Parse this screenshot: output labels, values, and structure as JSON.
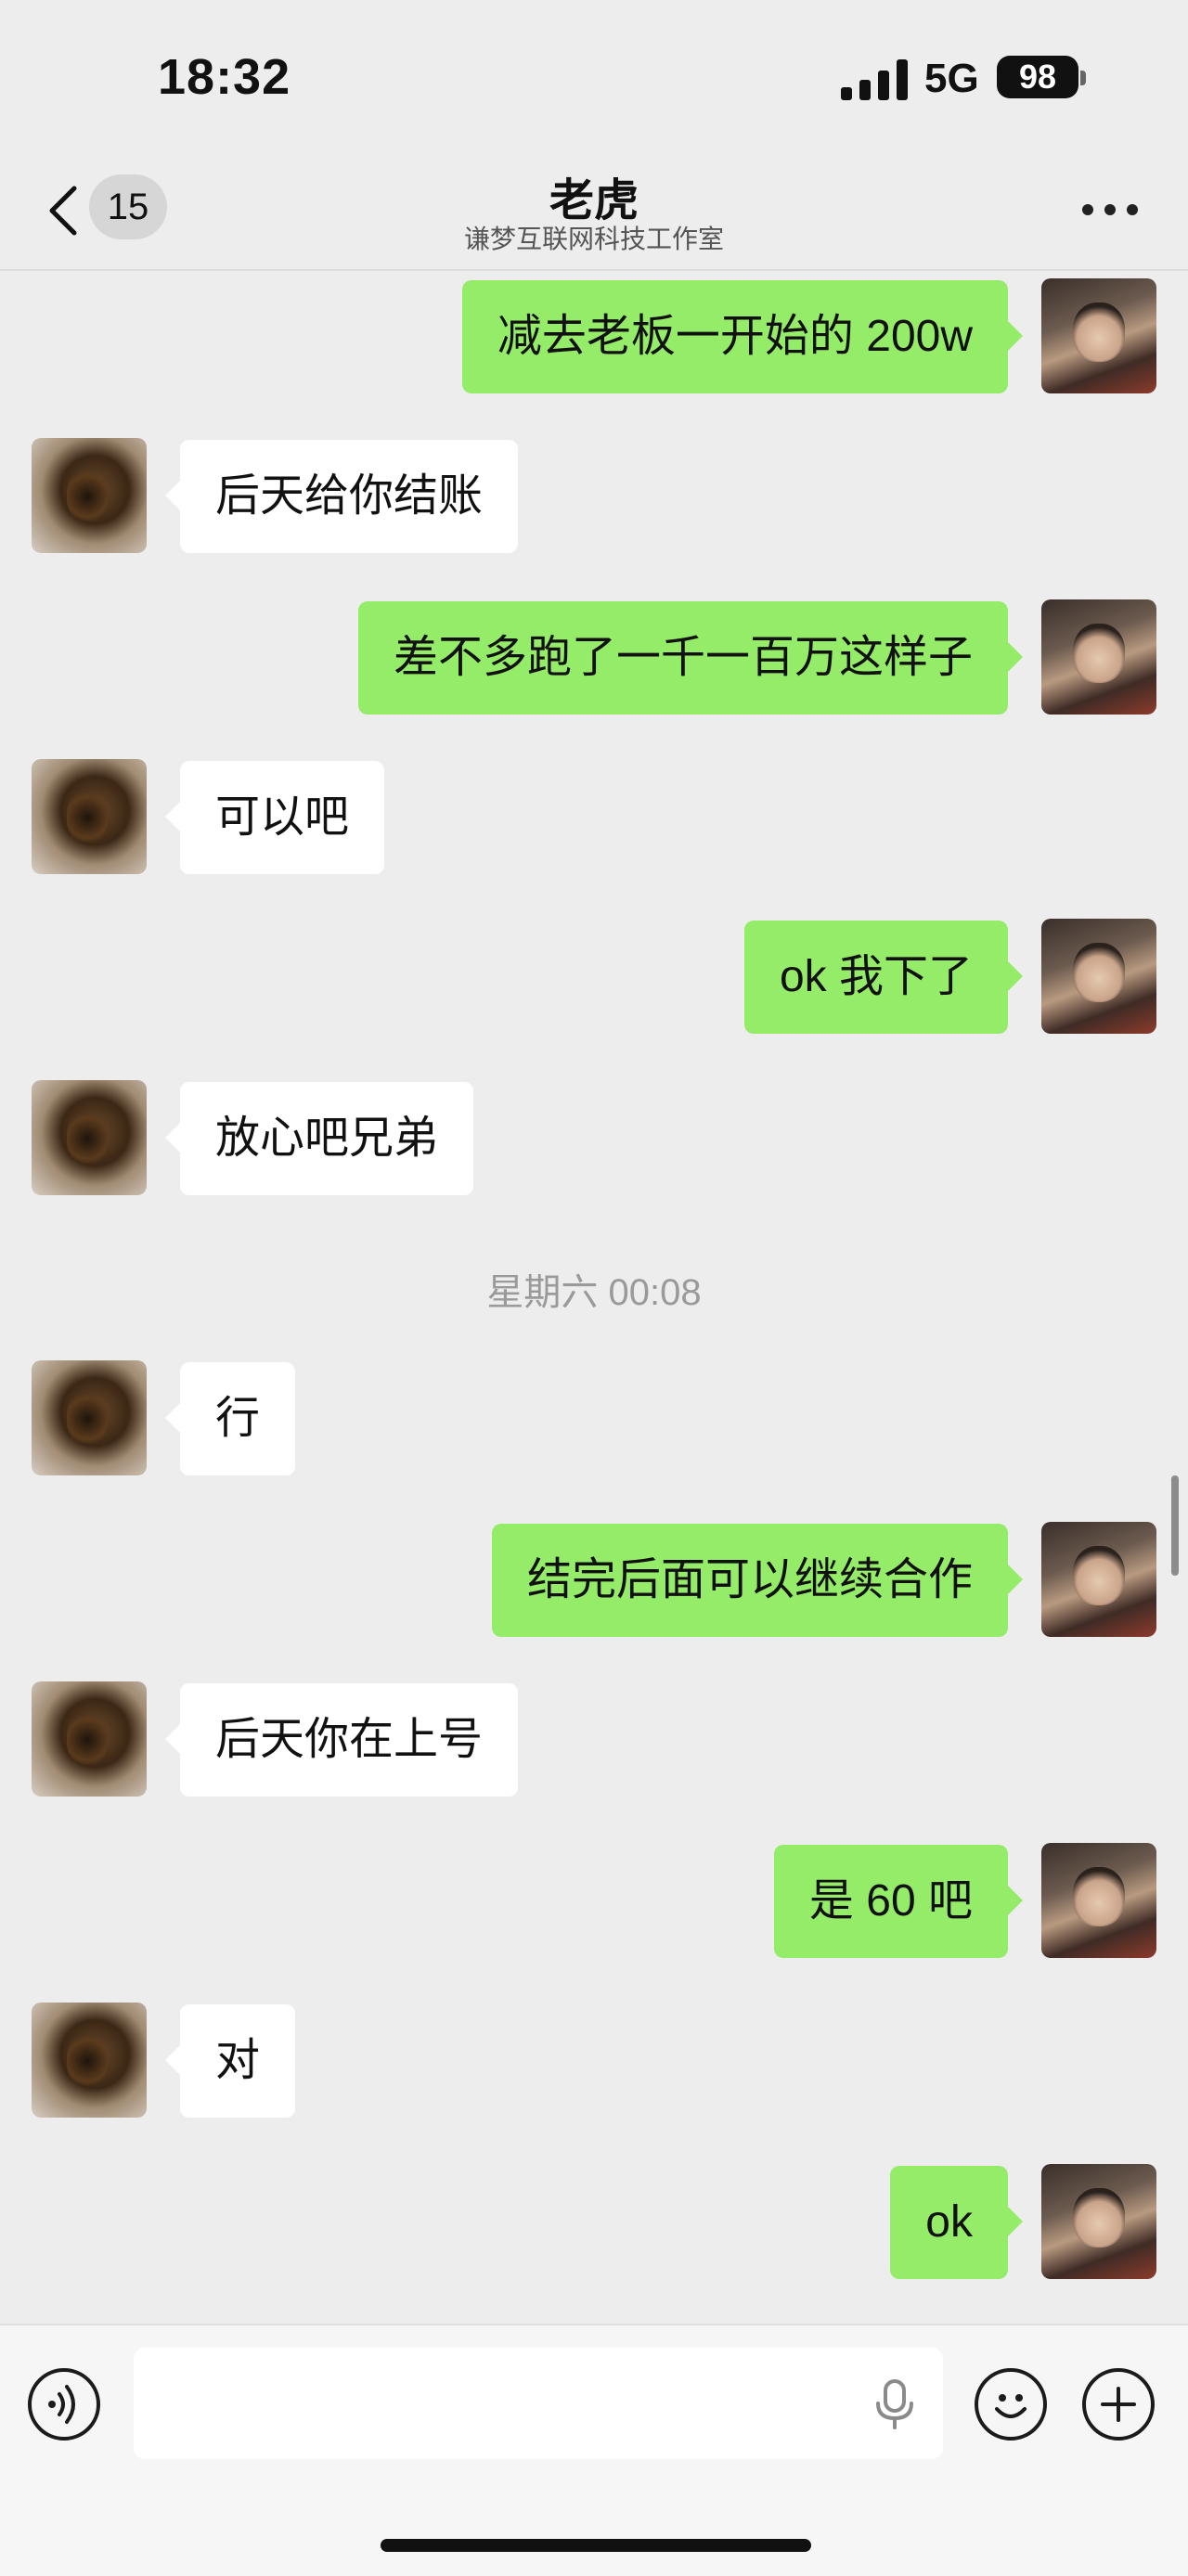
{
  "status_bar": {
    "time": "18:32",
    "network": "5G",
    "battery": "98"
  },
  "nav": {
    "back_badge": "15",
    "title": "老虎",
    "subtitle": "谦梦互联网科技工作室"
  },
  "messages": [
    {
      "side": "right",
      "text": "减去老板一开始的 200w"
    },
    {
      "side": "left",
      "text": "后天给你结账"
    },
    {
      "side": "right",
      "text": "差不多跑了一千一百万这样子"
    },
    {
      "side": "left",
      "text": "可以吧"
    },
    {
      "side": "right",
      "text": "ok 我下了"
    },
    {
      "side": "left",
      "text": "放心吧兄弟"
    },
    {
      "side": "left",
      "text": "行"
    },
    {
      "side": "right",
      "text": "结完后面可以继续合作"
    },
    {
      "side": "left",
      "text": "后天你在上号"
    },
    {
      "side": "right",
      "text": "是 60 吧"
    },
    {
      "side": "left",
      "text": "对"
    },
    {
      "side": "right",
      "text": "ok"
    }
  ],
  "timestamp": "星期六 00:08",
  "colors": {
    "sent_bubble": "#95ec69",
    "received_bubble": "#ffffff",
    "background": "#ededed"
  },
  "icons": {
    "voice": "voice-wave-icon",
    "emoji": "smiley-icon",
    "plus": "plus-circle-icon",
    "mic": "microphone-icon",
    "back": "chevron-left-icon",
    "more": "more-dots-icon"
  }
}
